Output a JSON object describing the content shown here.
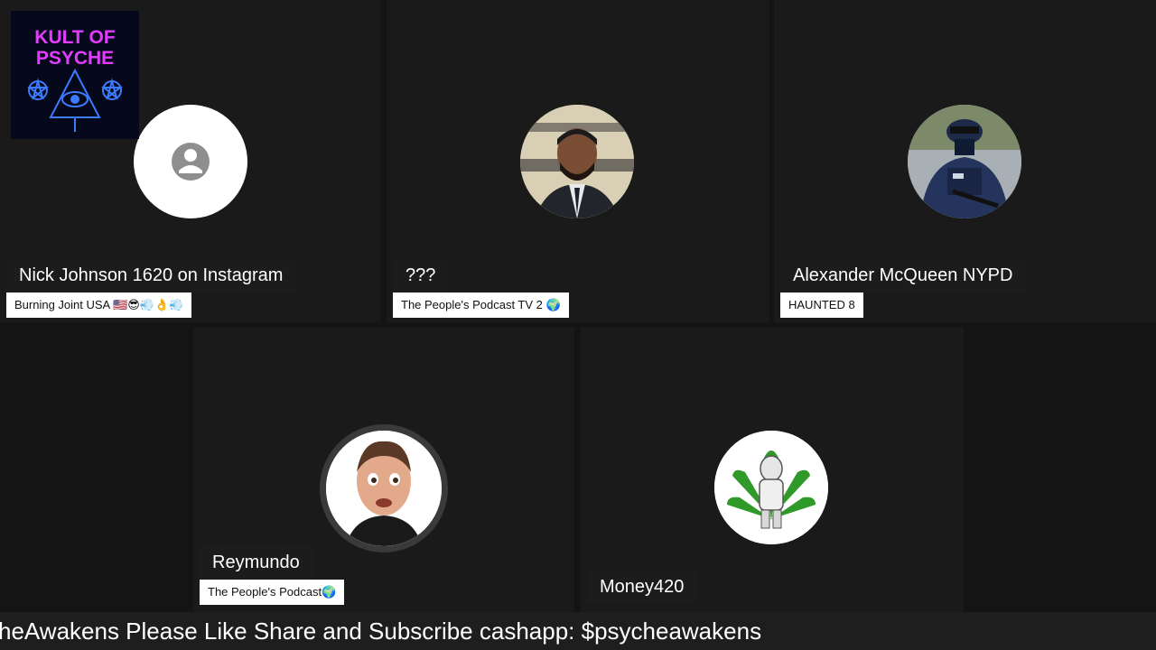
{
  "participants": [
    {
      "name": "Nick Johnson 1620 on Instagram",
      "subtitle": "Burning Joint USA 🇺🇸😎💨👌💨",
      "avatar": "default-user-icon"
    },
    {
      "name": "???",
      "subtitle": "The People's Podcast TV 2 🌍",
      "avatar": "man-in-suit-photo"
    },
    {
      "name": "Alexander McQueen NYPD",
      "subtitle": "HAUNTED 8",
      "avatar": "police-officer-photo"
    },
    {
      "name": "Reymundo",
      "subtitle": "The People's Podcast🌍",
      "avatar": "cartoon-boy-avatar"
    },
    {
      "name": "Money420",
      "subtitle": "",
      "avatar": "cannabis-leaf-logo"
    }
  ],
  "logo": {
    "line1": "KULT OF",
    "line2": "PSYCHE"
  },
  "ticker": {
    "text": "heAwakens Please Like Share and Subscribe cashapp: $psycheawakens"
  },
  "colors": {
    "logo_text": "#e23cff",
    "logo_art": "#3d7bff",
    "background": "#141414",
    "tile": "#1a1a1a",
    "subtitle_bg": "#ffffff"
  }
}
